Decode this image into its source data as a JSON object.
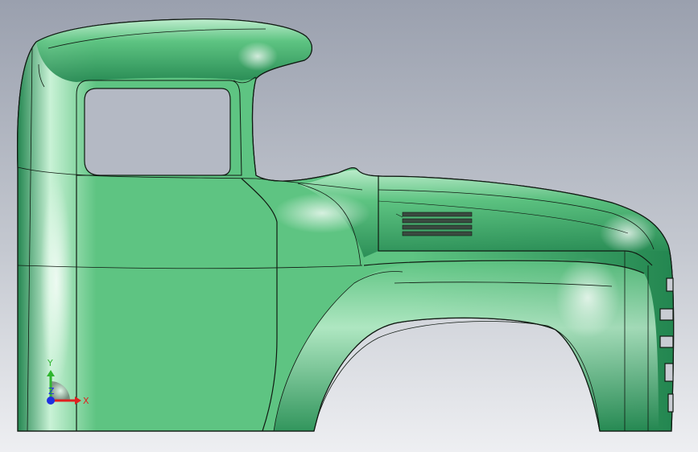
{
  "viewport": {
    "background_top": "#9aa0ae",
    "background_mid": "#c4c8d0",
    "background_bottom": "#eeeff2"
  },
  "model": {
    "body_color": "#5ec482",
    "body_highlight": "#c9f2d6",
    "body_shadow": "#238650",
    "edge_color": "#101a12",
    "window_fill": "#b4b9c4"
  },
  "triad": {
    "x_label": "X",
    "y_label": "Y",
    "z_label": "Z",
    "x_color": "#e02020",
    "y_color": "#2fb52f",
    "z_color": "#2030e0"
  }
}
